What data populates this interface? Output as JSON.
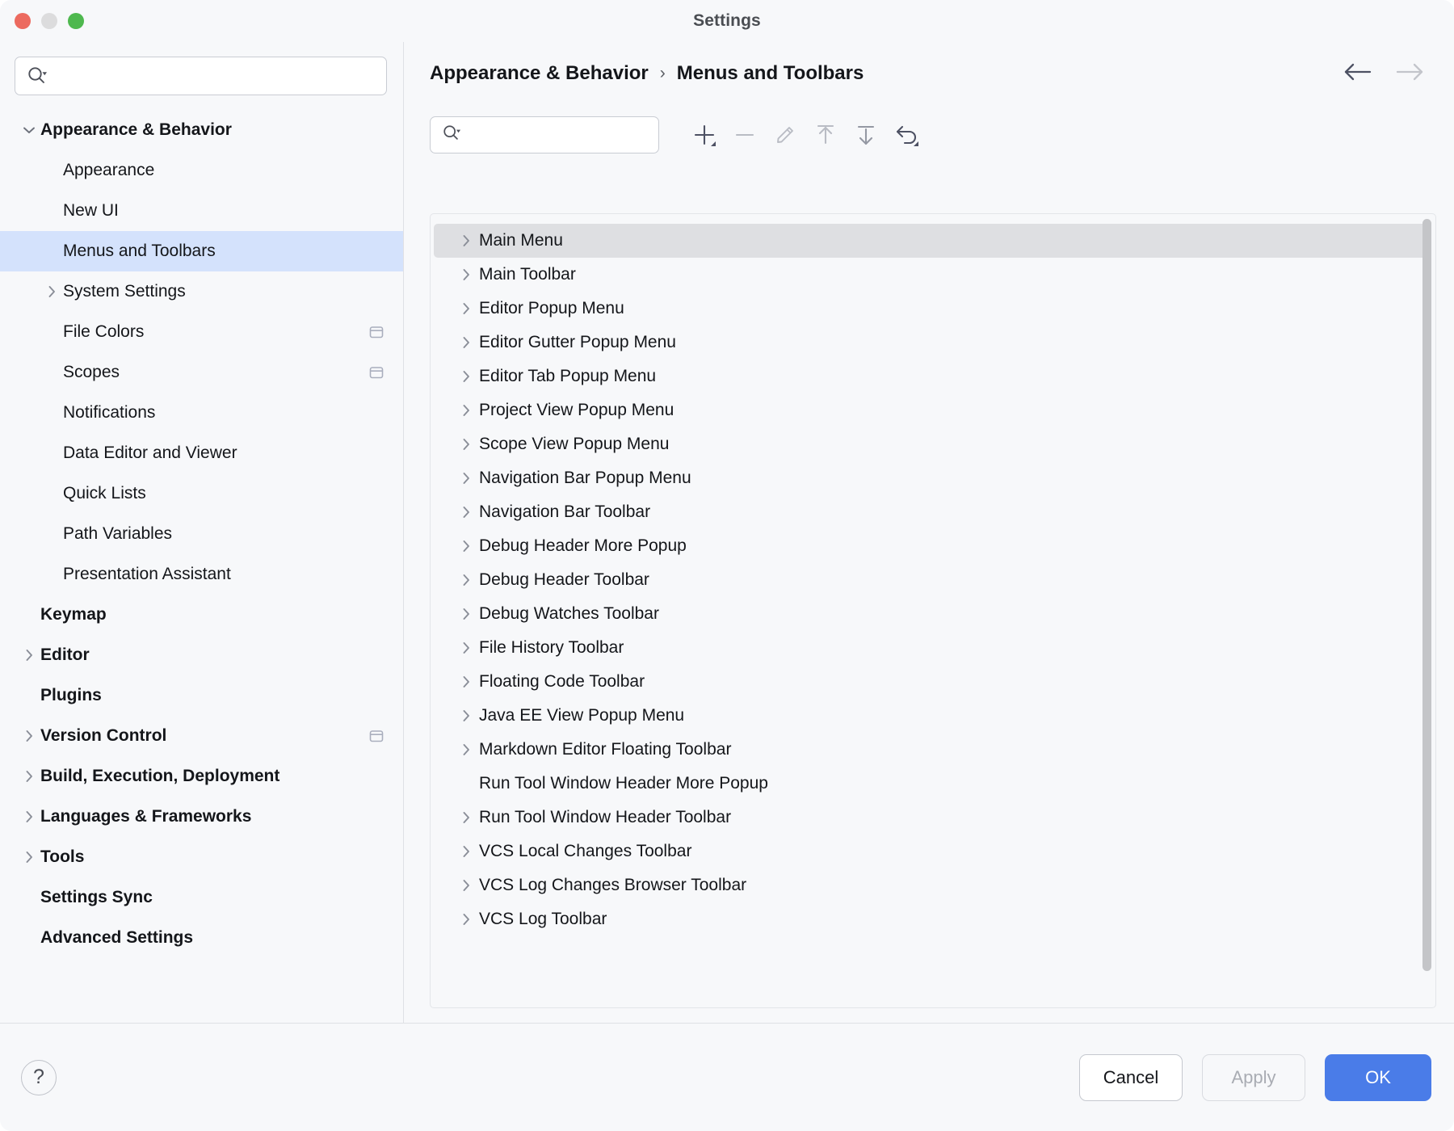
{
  "window": {
    "title": "Settings",
    "traffic_lights": [
      "close",
      "minimize",
      "maximize"
    ]
  },
  "sidebar": {
    "search": {
      "value": "",
      "placeholder": ""
    },
    "items": [
      {
        "label": "Appearance & Behavior",
        "depth": 0,
        "bold": true,
        "twisty": "down",
        "selected": false,
        "badge": false
      },
      {
        "label": "Appearance",
        "depth": 1,
        "bold": false,
        "twisty": "none",
        "selected": false,
        "badge": false
      },
      {
        "label": "New UI",
        "depth": 1,
        "bold": false,
        "twisty": "none",
        "selected": false,
        "badge": false
      },
      {
        "label": "Menus and Toolbars",
        "depth": 1,
        "bold": false,
        "twisty": "none",
        "selected": true,
        "badge": false
      },
      {
        "label": "System Settings",
        "depth": 1,
        "bold": false,
        "twisty": "right",
        "selected": false,
        "badge": false
      },
      {
        "label": "File Colors",
        "depth": 1,
        "bold": false,
        "twisty": "none",
        "selected": false,
        "badge": true
      },
      {
        "label": "Scopes",
        "depth": 1,
        "bold": false,
        "twisty": "none",
        "selected": false,
        "badge": true
      },
      {
        "label": "Notifications",
        "depth": 1,
        "bold": false,
        "twisty": "none",
        "selected": false,
        "badge": false
      },
      {
        "label": "Data Editor and Viewer",
        "depth": 1,
        "bold": false,
        "twisty": "none",
        "selected": false,
        "badge": false
      },
      {
        "label": "Quick Lists",
        "depth": 1,
        "bold": false,
        "twisty": "none",
        "selected": false,
        "badge": false
      },
      {
        "label": "Path Variables",
        "depth": 1,
        "bold": false,
        "twisty": "none",
        "selected": false,
        "badge": false
      },
      {
        "label": "Presentation Assistant",
        "depth": 1,
        "bold": false,
        "twisty": "none",
        "selected": false,
        "badge": false
      },
      {
        "label": "Keymap",
        "depth": 0,
        "bold": true,
        "twisty": "none",
        "selected": false,
        "badge": false
      },
      {
        "label": "Editor",
        "depth": 0,
        "bold": true,
        "twisty": "right",
        "selected": false,
        "badge": false
      },
      {
        "label": "Plugins",
        "depth": 0,
        "bold": true,
        "twisty": "none",
        "selected": false,
        "badge": false
      },
      {
        "label": "Version Control",
        "depth": 0,
        "bold": true,
        "twisty": "right",
        "selected": false,
        "badge": true
      },
      {
        "label": "Build, Execution, Deployment",
        "depth": 0,
        "bold": true,
        "twisty": "right",
        "selected": false,
        "badge": false
      },
      {
        "label": "Languages & Frameworks",
        "depth": 0,
        "bold": true,
        "twisty": "right",
        "selected": false,
        "badge": false
      },
      {
        "label": "Tools",
        "depth": 0,
        "bold": true,
        "twisty": "right",
        "selected": false,
        "badge": false
      },
      {
        "label": "Settings Sync",
        "depth": 0,
        "bold": true,
        "twisty": "none",
        "selected": false,
        "badge": false
      },
      {
        "label": "Advanced Settings",
        "depth": 0,
        "bold": true,
        "twisty": "none",
        "selected": false,
        "badge": false
      }
    ]
  },
  "main": {
    "breadcrumb": {
      "parent": "Appearance & Behavior",
      "separator": "›",
      "current": "Menus and Toolbars"
    },
    "nav": {
      "back_icon": "arrow-left-icon",
      "forward_icon": "arrow-right-icon",
      "back_enabled": true,
      "forward_enabled": false
    },
    "filter": {
      "value": "",
      "placeholder": ""
    },
    "toolbar": [
      {
        "name": "add-button",
        "icon": "plus-icon",
        "enabled": true,
        "dropdown": true
      },
      {
        "name": "remove-button",
        "icon": "minus-icon",
        "enabled": false,
        "dropdown": false
      },
      {
        "name": "edit-button",
        "icon": "pencil-icon",
        "enabled": false,
        "dropdown": false
      },
      {
        "name": "move-up-button",
        "icon": "arrow-up-to-line-icon",
        "enabled": false,
        "dropdown": false
      },
      {
        "name": "move-down-button",
        "icon": "arrow-down-from-line-icon",
        "enabled": true,
        "dropdown": false
      },
      {
        "name": "restore-button",
        "icon": "revert-arrow-icon",
        "enabled": true,
        "dropdown": true
      }
    ],
    "list": {
      "rows": [
        {
          "label": "Main Menu",
          "twisty": true,
          "selected": true
        },
        {
          "label": "Main Toolbar",
          "twisty": true,
          "selected": false
        },
        {
          "label": "Editor Popup Menu",
          "twisty": true,
          "selected": false
        },
        {
          "label": "Editor Gutter Popup Menu",
          "twisty": true,
          "selected": false
        },
        {
          "label": "Editor Tab Popup Menu",
          "twisty": true,
          "selected": false
        },
        {
          "label": "Project View Popup Menu",
          "twisty": true,
          "selected": false
        },
        {
          "label": "Scope View Popup Menu",
          "twisty": true,
          "selected": false
        },
        {
          "label": "Navigation Bar Popup Menu",
          "twisty": true,
          "selected": false
        },
        {
          "label": "Navigation Bar Toolbar",
          "twisty": true,
          "selected": false
        },
        {
          "label": "Debug Header More Popup",
          "twisty": true,
          "selected": false
        },
        {
          "label": "Debug Header Toolbar",
          "twisty": true,
          "selected": false
        },
        {
          "label": "Debug Watches Toolbar",
          "twisty": true,
          "selected": false
        },
        {
          "label": "File History Toolbar",
          "twisty": true,
          "selected": false
        },
        {
          "label": "Floating Code Toolbar",
          "twisty": true,
          "selected": false
        },
        {
          "label": "Java EE View Popup Menu",
          "twisty": true,
          "selected": false
        },
        {
          "label": "Markdown Editor Floating Toolbar",
          "twisty": true,
          "selected": false
        },
        {
          "label": "Run Tool Window Header More Popup",
          "twisty": false,
          "selected": false
        },
        {
          "label": "Run Tool Window Header Toolbar",
          "twisty": true,
          "selected": false
        },
        {
          "label": "VCS Local Changes Toolbar",
          "twisty": true,
          "selected": false
        },
        {
          "label": "VCS Log Changes Browser Toolbar",
          "twisty": true,
          "selected": false
        },
        {
          "label": "VCS Log Toolbar",
          "twisty": true,
          "selected": false
        }
      ],
      "scrollbar": {
        "visible": true,
        "thumb_percent": 96
      }
    }
  },
  "footer": {
    "help_label": "?",
    "cancel_label": "Cancel",
    "apply_label": "Apply",
    "apply_enabled": false,
    "ok_label": "OK"
  },
  "colors": {
    "accent": "#4a7ce8",
    "selection_sidebar": "#d4e2fc",
    "selection_list": "#dedfe2",
    "surface": "#f7f8fa",
    "border": "#dfe1e5",
    "traffic_close": "#ec6a5f",
    "traffic_min": "#dcdcdd",
    "traffic_max": "#4eb84e"
  }
}
